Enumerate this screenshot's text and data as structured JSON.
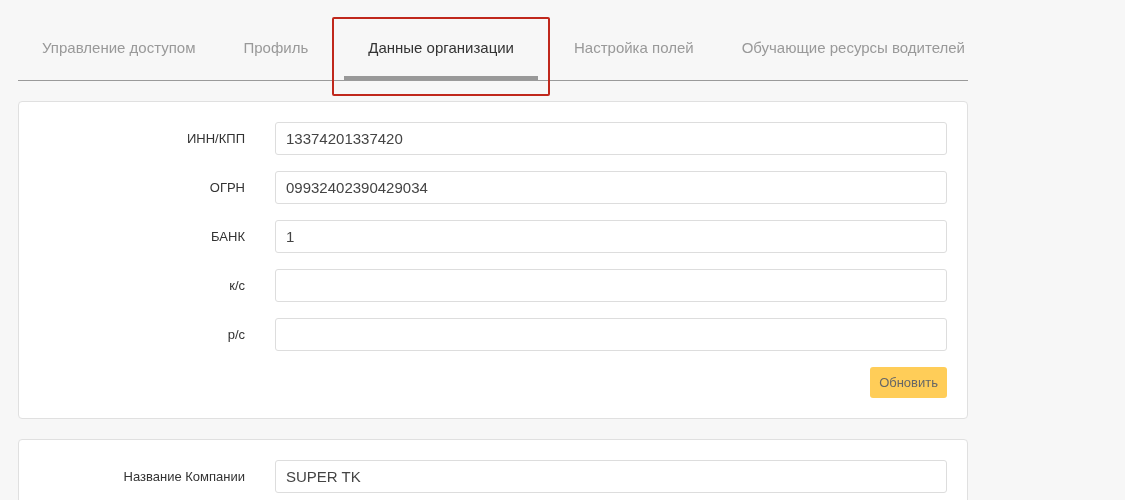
{
  "tabs": [
    {
      "label": "Управление доступом",
      "selected": false,
      "highlighted": false
    },
    {
      "label": "Профиль",
      "selected": false,
      "highlighted": false
    },
    {
      "label": "Данные организации",
      "selected": true,
      "highlighted": true
    },
    {
      "label": "Настройка полей",
      "selected": false,
      "highlighted": false
    },
    {
      "label": "Обучающие ресурсы водителей",
      "selected": false,
      "highlighted": false
    }
  ],
  "cards": [
    {
      "fields": [
        {
          "label": "ИНН/КПП",
          "value": "13374201337420"
        },
        {
          "label": "ОГРН",
          "value": "09932402390429034"
        },
        {
          "label": "БАНК",
          "value": "1"
        },
        {
          "label": "к/с"
        },
        {
          "label": "р/с"
        }
      ],
      "button": "Обновить"
    },
    {
      "fields": [
        {
          "label": "Название Компании",
          "value": "SUPER TK"
        }
      ]
    }
  ]
}
